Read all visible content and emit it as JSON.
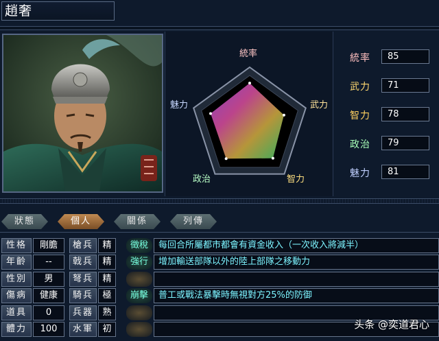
{
  "officer_name": "趙奢",
  "radar": {
    "axes": [
      {
        "key": "tong",
        "label": "統率"
      },
      {
        "key": "wu",
        "label": "武力"
      },
      {
        "key": "zhi",
        "label": "智力"
      },
      {
        "key": "zheng",
        "label": "政治"
      },
      {
        "key": "mei",
        "label": "魅力"
      }
    ]
  },
  "stats": [
    {
      "label": "統率",
      "value": "85",
      "color": "#ffc0c0"
    },
    {
      "label": "武力",
      "value": "71",
      "color": "#ffd870"
    },
    {
      "label": "智力",
      "value": "78",
      "color": "#ffd060"
    },
    {
      "label": "政治",
      "value": "79",
      "color": "#a8ffb8"
    },
    {
      "label": "魅力",
      "value": "81",
      "color": "#c0d0ff"
    }
  ],
  "tabs": [
    {
      "label": "狀態",
      "active": false
    },
    {
      "label": "個人",
      "active": true
    },
    {
      "label": "關係",
      "active": false
    },
    {
      "label": "列傳",
      "active": false
    }
  ],
  "personal": [
    {
      "label": "性格",
      "value": "剛膽"
    },
    {
      "label": "年齡",
      "value": "--"
    },
    {
      "label": "性別",
      "value": "男"
    },
    {
      "label": "傷病",
      "value": "健康"
    },
    {
      "label": "道具",
      "value": "0"
    },
    {
      "label": "體力",
      "value": "100"
    }
  ],
  "troops": [
    {
      "label": "槍兵",
      "value": "精"
    },
    {
      "label": "戟兵",
      "value": "精"
    },
    {
      "label": "弩兵",
      "value": "精"
    },
    {
      "label": "騎兵",
      "value": "極"
    },
    {
      "label": "兵器",
      "value": "熟"
    },
    {
      "label": "水軍",
      "value": "初"
    }
  ],
  "skills": [
    {
      "name": "徵稅",
      "desc": "每回合所屬都市都會有資金收入（一次收入將減半）",
      "active": true
    },
    {
      "name": "強行",
      "desc": "增加輸送部隊以外的陸上部隊之移動力",
      "active": true
    },
    {
      "name": "",
      "desc": "",
      "active": false
    },
    {
      "name": "崩擊",
      "desc": "普工或戰法暴擊時無視對方25%的防御",
      "active": true
    },
    {
      "name": "",
      "desc": "",
      "active": false
    },
    {
      "name": "",
      "desc": "",
      "active": false
    }
  ],
  "watermark": "头条 @奕道君心"
}
